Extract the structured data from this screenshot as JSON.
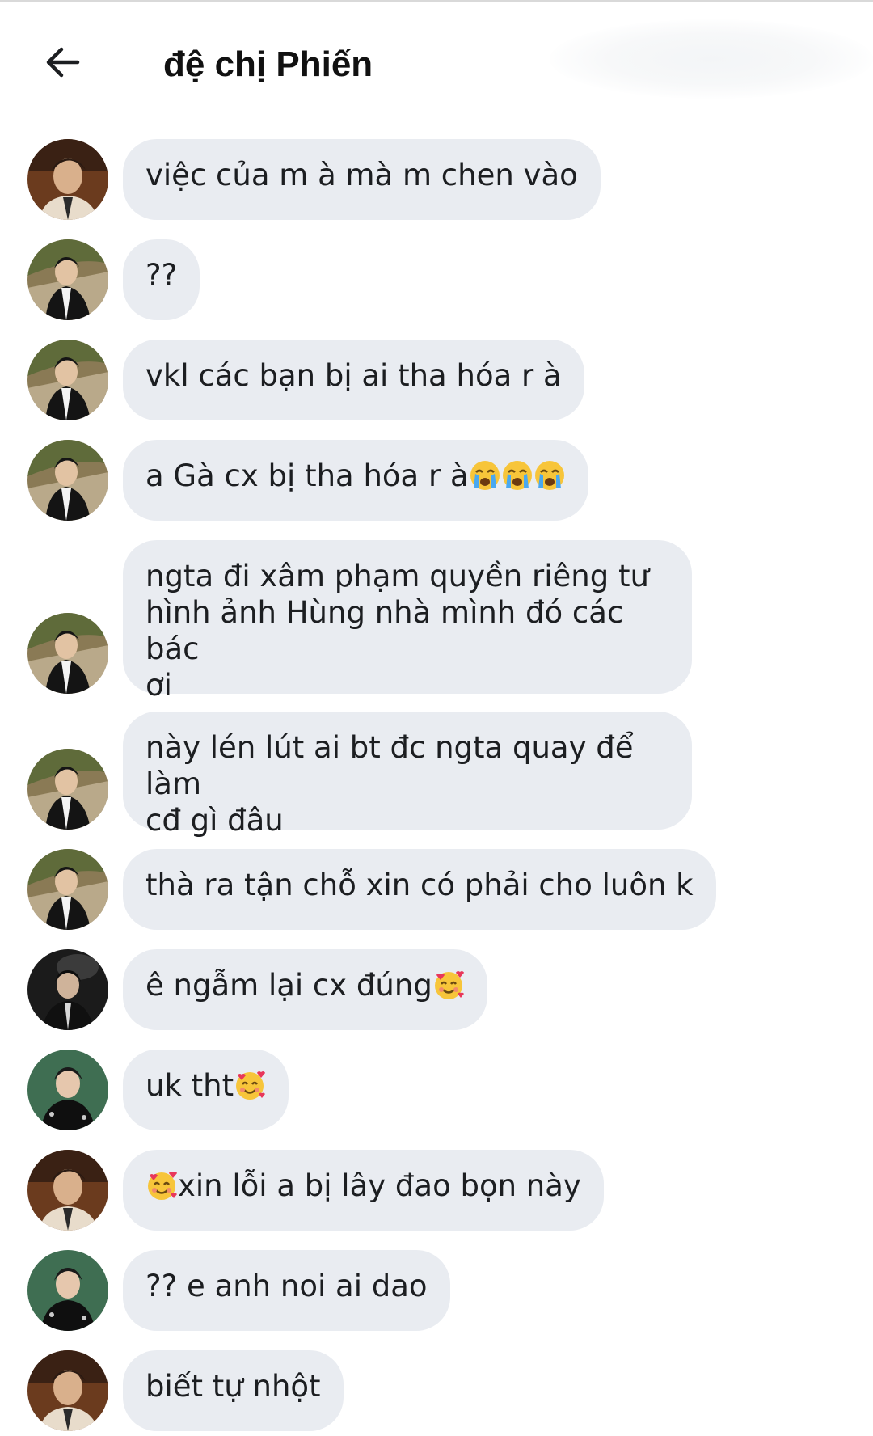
{
  "header": {
    "title": "đệ chị Phiến",
    "back_icon": "arrow-left-icon"
  },
  "colors": {
    "bubble": "#e9ecf1",
    "text": "#1c1e21",
    "background": "#ffffff"
  },
  "messages": [
    {
      "avatar": "avatar-warm-portrait",
      "text": "việc của m à mà m chen vào"
    },
    {
      "avatar": "avatar-outdoor-black-jacket",
      "text": "??"
    },
    {
      "avatar": "avatar-outdoor-black-jacket",
      "text": "vkl các bạn bị ai tha hóa r à"
    },
    {
      "avatar": "avatar-outdoor-black-jacket",
      "text": "a Gà cx bị tha hóa r à",
      "trailing_emojis": [
        "crying-face-emoji",
        "crying-face-emoji",
        "crying-face-emoji"
      ]
    },
    {
      "avatar": "avatar-outdoor-black-jacket",
      "lines": [
        "ngta đi xâm phạm quyền riêng tư",
        "hình ảnh Hùng nhà mình đó các bác",
        "ơi"
      ]
    },
    {
      "avatar": "avatar-outdoor-black-jacket",
      "lines": [
        "này lén lút ai bt đc ngta quay để làm",
        "cđ gì đâu"
      ]
    },
    {
      "avatar": "avatar-outdoor-black-jacket",
      "text": "thà ra tận chỗ xin có phải cho luôn k"
    },
    {
      "avatar": "avatar-dark-portrait",
      "text": "ê ngẫm lại cx đúng",
      "trailing_emojis": [
        "smiling-face-with-hearts-emoji"
      ]
    },
    {
      "avatar": "avatar-green-background",
      "text": "uk tht",
      "trailing_emojis": [
        "smiling-face-with-hearts-emoji"
      ]
    },
    {
      "avatar": "avatar-warm-portrait",
      "text": "xin lỗi a bị lây đao bọn này",
      "leading_emojis": [
        "smiling-face-with-hearts-emoji"
      ]
    },
    {
      "avatar": "avatar-green-background",
      "text": "?? e anh noi ai dao"
    },
    {
      "avatar": "avatar-warm-portrait",
      "text": "biết tự nhột"
    }
  ]
}
